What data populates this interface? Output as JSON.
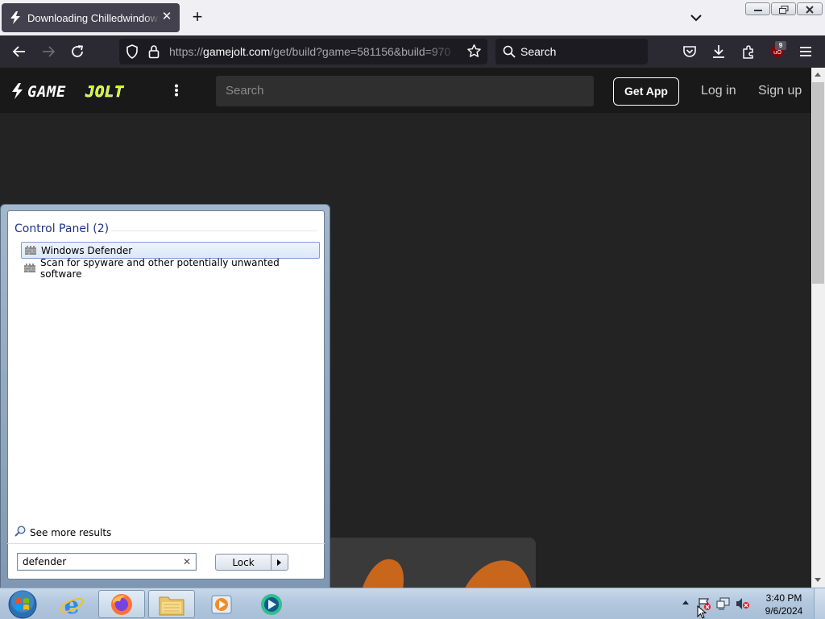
{
  "browser": {
    "tab": {
      "title": "Downloading Chilledwindows.exe"
    },
    "url": {
      "host": "gamejolt.com",
      "scheme": "https://",
      "path": "/get/build?game=581156&build=970"
    },
    "search_placeholder": "Search",
    "extension_badge": "9"
  },
  "site": {
    "logo": "GAME JOLT",
    "search_placeholder": "Search",
    "get_app": "Get App",
    "login": "Log in",
    "signup": "Sign up"
  },
  "startmenu": {
    "group_label": "Control Panel (2)",
    "results": [
      {
        "label": "Windows Defender",
        "selected": true
      },
      {
        "label": "Scan for spyware and other potentially unwanted software",
        "selected": false
      }
    ],
    "see_more": "See more results",
    "search_value": "defender",
    "lock_label": "Lock"
  },
  "taskbar": {
    "apps": [
      "start-orb",
      "internet-explorer",
      "firefox",
      "windows-explorer",
      "media-player",
      "app"
    ],
    "time": "3:40 PM",
    "date": "9/6/2024"
  },
  "colors": {
    "gj_green": "#ccff00",
    "firefox_bg": "#2b2a33",
    "page_bg": "#232323"
  }
}
